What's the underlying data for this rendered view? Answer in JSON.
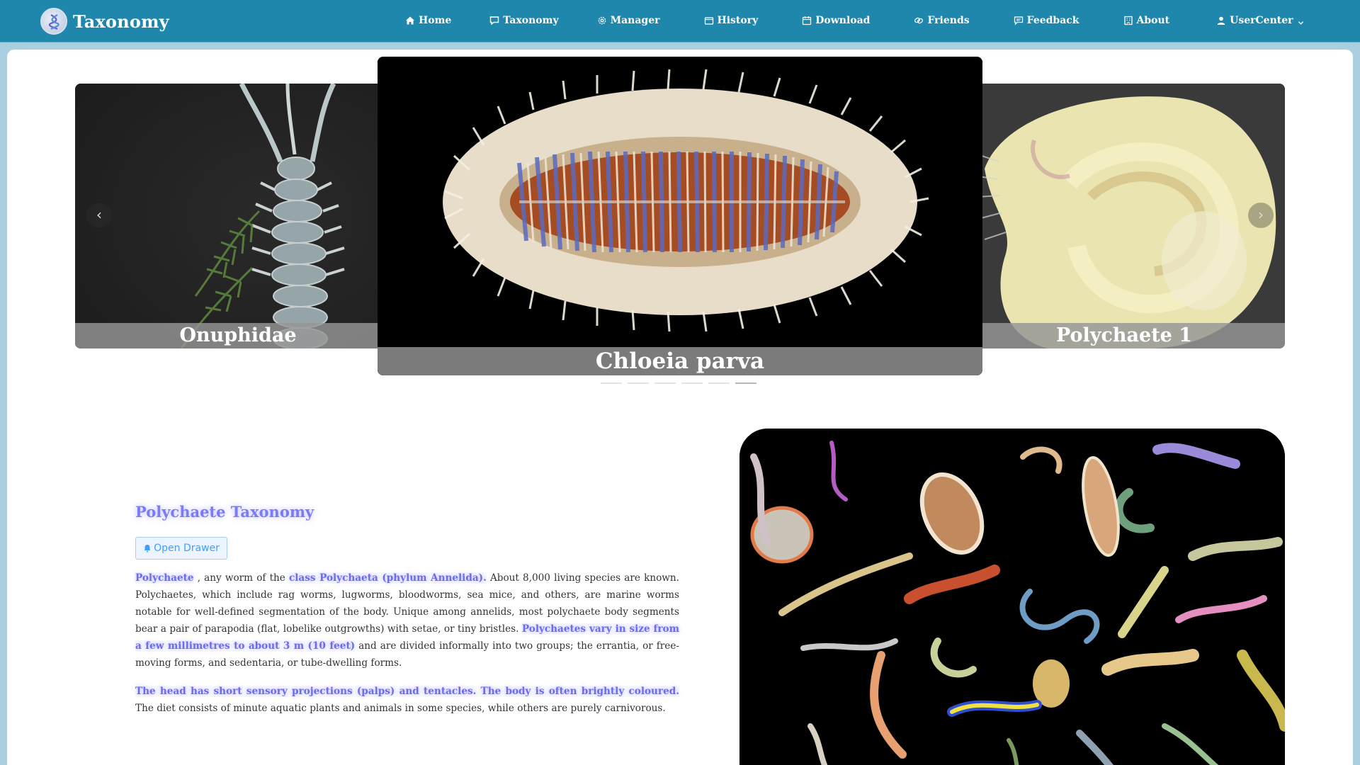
{
  "brand": {
    "name": "Taxonomy",
    "logo_icon": "dna-logo-icon"
  },
  "nav": {
    "items": [
      {
        "label": "Home",
        "icon": "home-icon"
      },
      {
        "label": "Taxonomy",
        "icon": "chat-icon"
      },
      {
        "label": "Manager",
        "icon": "gear-icon"
      },
      {
        "label": "History",
        "icon": "folder-icon"
      },
      {
        "label": "Download",
        "icon": "calendar-icon"
      },
      {
        "label": "Friends",
        "icon": "link-icon"
      },
      {
        "label": "Feedback",
        "icon": "message-icon"
      },
      {
        "label": "About",
        "icon": "building-icon"
      },
      {
        "label": "UserCenter",
        "icon": "user-icon",
        "dropdown": true
      }
    ]
  },
  "carousel": {
    "prev_label": "‹",
    "next_label": "›",
    "slides": {
      "left": "Onuphidae",
      "center": "Chloeia parva",
      "right": "Polychaete 1"
    },
    "indicator_count": 6,
    "active_indicator": 6
  },
  "content": {
    "title": "Polychaete Taxonomy",
    "drawer_button": "Open Drawer",
    "p1": {
      "s1": "Polychaete",
      "s2": " , any worm of the ",
      "s3": "class Polychaeta (phylum Annelida).",
      "s4": " About 8,000 living species are known. Polychaetes, which include rag worms, lugworms, bloodworms, sea mice, and others, are marine worms notable for well-defined segmentation of the body. Unique among annelids, most polychaete body segments bear a pair of parapodia (flat, lobelike outgrowths) with setae, or tiny bristles. ",
      "s5": "Polychaetes vary in size from a few millimetres to about 3 m (10 feet)",
      "s6": " and are divided informally into two groups; the errantia, or free-moving forms, and sedentaria, or tube-dwelling forms."
    },
    "p2": {
      "s1": "The head has short sensory projections (palps) and tentacles. The body is often brightly coloured.",
      "s2": " The diet consists of minute aquatic plants and animals in some species, while others are purely carnivorous."
    }
  },
  "colors": {
    "nav_bg": "#1f87ac",
    "page_bg": "#a9cfe0",
    "highlight": "#6b6bf0",
    "button_blue": "#409eff"
  }
}
